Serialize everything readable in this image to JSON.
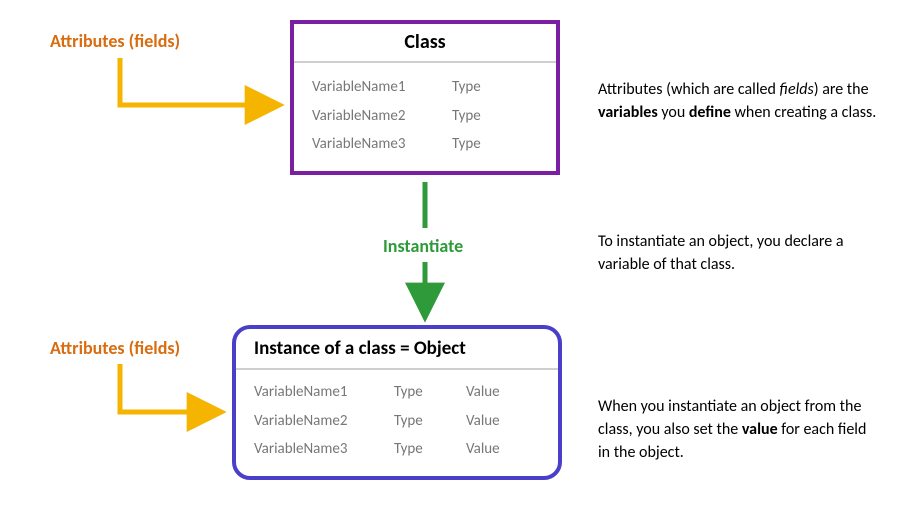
{
  "labels": {
    "attributes1_prefix": "Attributes ",
    "attributes1_fields": "(fields)",
    "attributes2_prefix": "Attributes ",
    "attributes2_fields": "(fields)",
    "instantiate": "Instantiate"
  },
  "class_box": {
    "title": "Class",
    "rows": [
      {
        "name": "VariableName1",
        "type": "Type"
      },
      {
        "name": "VariableName2",
        "type": "Type"
      },
      {
        "name": "VariableName3",
        "type": "Type"
      }
    ]
  },
  "instance_box": {
    "title": "Instance of a class = Object",
    "rows": [
      {
        "name": "VariableName1",
        "type": "Type",
        "value": "Value"
      },
      {
        "name": "VariableName2",
        "type": "Type",
        "value": "Value"
      },
      {
        "name": "VariableName3",
        "type": "Type",
        "value": "Value"
      }
    ]
  },
  "notes": {
    "attributes": {
      "pre": "Attributes (which are called ",
      "italic": "fields",
      "mid": ") are the ",
      "bold1": "variables",
      "mid2": " you ",
      "bold2": "define",
      "post": " when creating a class."
    },
    "instantiate": "To instantiate an object, you declare a variable of that class.",
    "value": {
      "pre": "When you instantiate an object from the class, you also set the ",
      "bold": "value",
      "post": " for each field in the object."
    }
  },
  "colors": {
    "orange": "#d96c0f",
    "yellow": "#f4b400",
    "green": "#2e9a3a",
    "purple": "#7a1fa2",
    "indigo": "#4a3fc9"
  }
}
